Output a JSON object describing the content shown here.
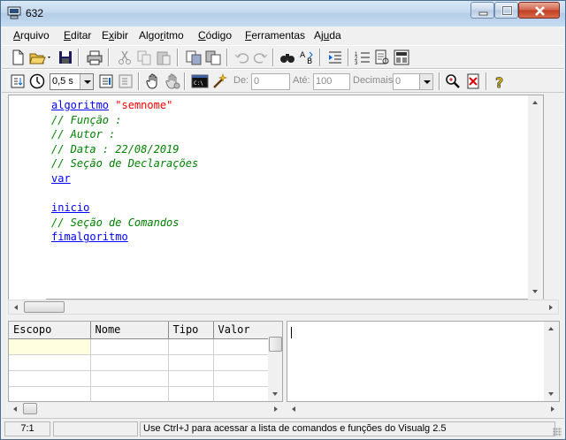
{
  "window": {
    "title": "632",
    "app_icon": "computer-icon",
    "controls": [
      "minimize-icon",
      "maximize-icon",
      "close-icon"
    ]
  },
  "menu": [
    {
      "label": "Arquivo",
      "mnemonic": "A",
      "rest": "rquivo"
    },
    {
      "label": "Editar",
      "mnemonic": "E",
      "rest": "ditar"
    },
    {
      "label": "Exibir",
      "mnemonic": "x",
      "prefix": "E",
      "rest": "ibir"
    },
    {
      "label": "Algoritmo",
      "prefix": "Algo",
      "mnemonic": "r",
      "rest": "itmo"
    },
    {
      "label": "Código",
      "mnemonic": "C",
      "rest": "ódigo"
    },
    {
      "label": "Ferramentas",
      "mnemonic": "F",
      "rest": "erramentas"
    },
    {
      "label": "Ajuda",
      "prefix": "Aj",
      "mnemonic": "u",
      "rest": "da"
    }
  ],
  "toolbar": {
    "speed": "0,5 s",
    "de_label": "De:",
    "de_value": "0",
    "ate_label": "Até:",
    "ate_value": "100",
    "decimais_label": "Decimais:",
    "decimais_value": "0"
  },
  "editor": {
    "lines": [
      [
        {
          "t": "algoritmo",
          "c": "kw"
        },
        {
          "t": " "
        },
        {
          "t": "\"semnome\"",
          "c": "str"
        }
      ],
      [
        {
          "t": "// Função :",
          "c": "cm"
        }
      ],
      [
        {
          "t": "// Autor :",
          "c": "cm"
        }
      ],
      [
        {
          "t": "// Data : 22/08/2019",
          "c": "cm"
        }
      ],
      [
        {
          "t": "// Seção de Declarações",
          "c": "cm"
        }
      ],
      [
        {
          "t": "var",
          "c": "kw"
        }
      ],
      [
        {
          "t": ""
        }
      ],
      [
        {
          "t": "inicio",
          "c": "kw"
        }
      ],
      [
        {
          "t": "// Seção de Comandos",
          "c": "cm"
        }
      ],
      [
        {
          "t": "fimalgoritmo",
          "c": "kw"
        }
      ]
    ],
    "colors": {
      "keyword": "#0000ff",
      "string": "#ff0000",
      "comment": "#008000"
    }
  },
  "variables": {
    "columns": [
      "Escopo",
      "Nome",
      "Tipo",
      "Valor"
    ]
  },
  "status": {
    "position": "7:1",
    "modified": "",
    "message": "Use Ctrl+J para acessar a lista de comandos e funções do Visualg 2.5"
  }
}
